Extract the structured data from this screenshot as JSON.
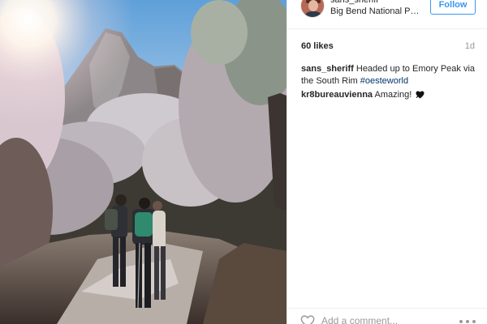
{
  "post": {
    "image_alt": "Three hikers on a frosty trail below a rocky peak",
    "author": {
      "username": "sans_sheriff",
      "location": "Big Bend National Park",
      "follow_label": "Follow"
    },
    "likes": "60 likes",
    "age": "1d",
    "caption": {
      "username": "sans_sheriff",
      "text": "Headed up to Emory Peak via the South Rim",
      "hashtag": "#oesteworld"
    },
    "comments": [
      {
        "username": "kr8bureauvienna",
        "text": "Amazing!",
        "emoji": "heart-emoji"
      }
    ],
    "comment_input": {
      "placeholder": "Add a comment..."
    }
  },
  "icons": {
    "like": "heart-outline-icon",
    "more": "more-options-icon"
  },
  "colors": {
    "link_blue": "#3897f0",
    "hashtag": "#003569",
    "text": "#262626",
    "muted": "#999999"
  }
}
